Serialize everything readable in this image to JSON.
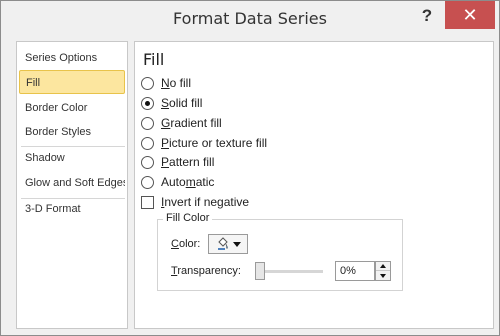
{
  "window": {
    "title": "Format Data Series",
    "help_label": "?",
    "close_label": "✕"
  },
  "sidebar": {
    "items": [
      {
        "label": "Series Options"
      },
      {
        "label": "Fill",
        "selected": true
      },
      {
        "label": "Border Color"
      },
      {
        "label": "Border Styles"
      },
      {
        "label": "Shadow"
      },
      {
        "label": "Glow and Soft Edges"
      },
      {
        "label": "3-D Format"
      }
    ]
  },
  "panel": {
    "title": "Fill",
    "options": [
      {
        "key": "N",
        "rest": "o fill",
        "checked": false
      },
      {
        "key": "S",
        "rest": "olid fill",
        "checked": true
      },
      {
        "key": "G",
        "rest": "radient fill",
        "checked": false
      },
      {
        "key": "P",
        "rest": "icture or texture fill",
        "checked": false
      },
      {
        "key": "P",
        "rest": "attern fill",
        "checked": false
      },
      {
        "pre": "Auto",
        "key": "m",
        "rest": "atic",
        "checked": false
      }
    ],
    "invert": {
      "key": "I",
      "rest": "nvert if negative",
      "checked": false
    },
    "fill_color": {
      "group_label": "Fill Color",
      "color_key": "C",
      "color_rest": "olor:",
      "transparency_key": "T",
      "transparency_rest": "ransparency:",
      "transparency_value": "0%",
      "transparency_fraction": 0,
      "bucket_icon": "paint-bucket-icon"
    }
  },
  "colors": {
    "close_bg": "#c75050",
    "selected_bg": "#fce69f"
  }
}
